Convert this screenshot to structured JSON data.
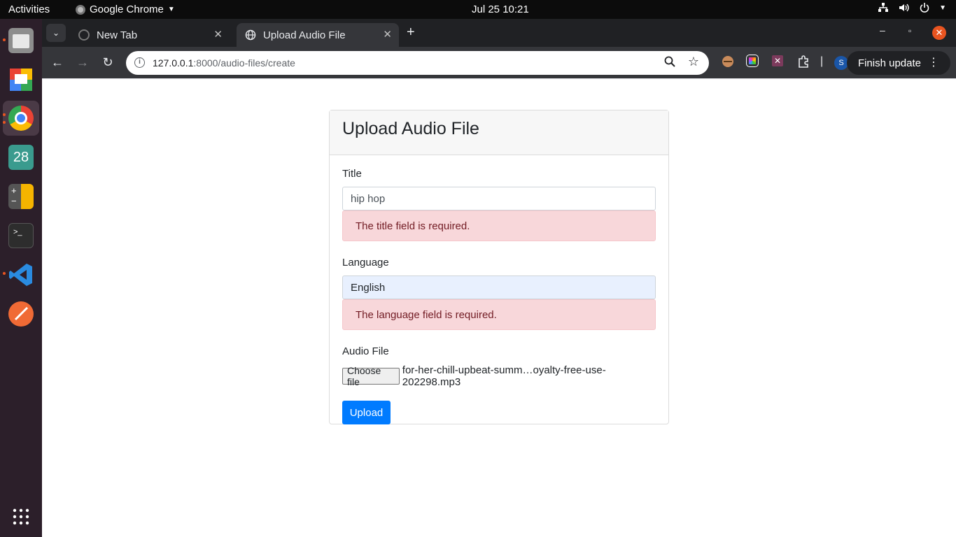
{
  "system": {
    "activities_label": "Activities",
    "app_name": "Google Chrome",
    "clock": "Jul 25  10:21"
  },
  "dock": {
    "items": [
      "Files",
      "Google Chat",
      "Google Chrome",
      "Calendar",
      "Calculator",
      "Terminal",
      "Visual Studio Code",
      "Postman",
      "Show Applications"
    ],
    "calendar_day": "28"
  },
  "browser": {
    "tabs": [
      {
        "title": "New Tab",
        "active": false
      },
      {
        "title": "Upload Audio File",
        "active": true
      }
    ],
    "url_host": "127.0.0.1",
    "url_path": ":8000/audio-files/create",
    "profile_initial": "S",
    "finish_update_label": "Finish update"
  },
  "page": {
    "heading": "Upload Audio File",
    "title_label": "Title",
    "title_value": "hip hop",
    "title_error": "The title field is required.",
    "language_label": "Language",
    "language_value": "English",
    "language_error": "The language field is required.",
    "audio_label": "Audio File",
    "choose_file_label": "Choose file",
    "file_name": "for-her-chill-upbeat-summ…oyalty-free-use-202298.mp3",
    "upload_label": "Upload"
  },
  "colors": {
    "accent": "#007bff",
    "error_bg": "#f8d7da",
    "error_text": "#721c24",
    "ubuntu_orange": "#e95420"
  }
}
